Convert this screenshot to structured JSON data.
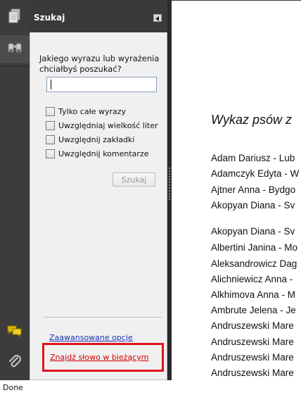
{
  "panel": {
    "title": "Szukaj",
    "question": "Jakiego wyrazu lub wyrażenia chciałbyś poszukać?",
    "search_value": "",
    "options": [
      {
        "label": "Tylko całe wyrazy",
        "checked": false
      },
      {
        "label": "Uwzględniaj wielkość liter",
        "checked": false
      },
      {
        "label": "Uwzględnij zakładki",
        "checked": false
      },
      {
        "label": "Uwzględnij komentarze",
        "checked": false
      }
    ],
    "search_button": "Szukaj",
    "advanced_link": "Zaawansowane opcje",
    "find_in_current_link": "Znajdź słowo w bieżącym"
  },
  "document": {
    "title": "Wykaz psów z",
    "lines": [
      "Adam Dariusz - Lub",
      "Adamczyk Edyta - W",
      "Ajtner Anna - Bydgo",
      "Akopyan Diana - Sv",
      "Akopyan Diana - Sv",
      "Albertini Janina - Mo",
      "Aleksandrowicz Dag",
      "Alichniewicz Anna -",
      "Alkhimova Anna - M",
      "Ambrute Jelena - Je",
      "Andruszewski Mare",
      "Andruszewski Mare",
      "Andruszewski Mare",
      "Andruszewski Mare"
    ]
  },
  "toolbar": {
    "icons": [
      "pages-icon",
      "search-binoculars-icon",
      "comments-icon",
      "attachments-icon"
    ]
  },
  "status": {
    "text": "Done"
  },
  "colors": {
    "toolbar_bg": "#3c3c3c",
    "panel_bg": "#f0f0f0",
    "link_blue": "#1a2fb8",
    "link_red": "#d30000",
    "highlight_red": "#e2131b"
  }
}
